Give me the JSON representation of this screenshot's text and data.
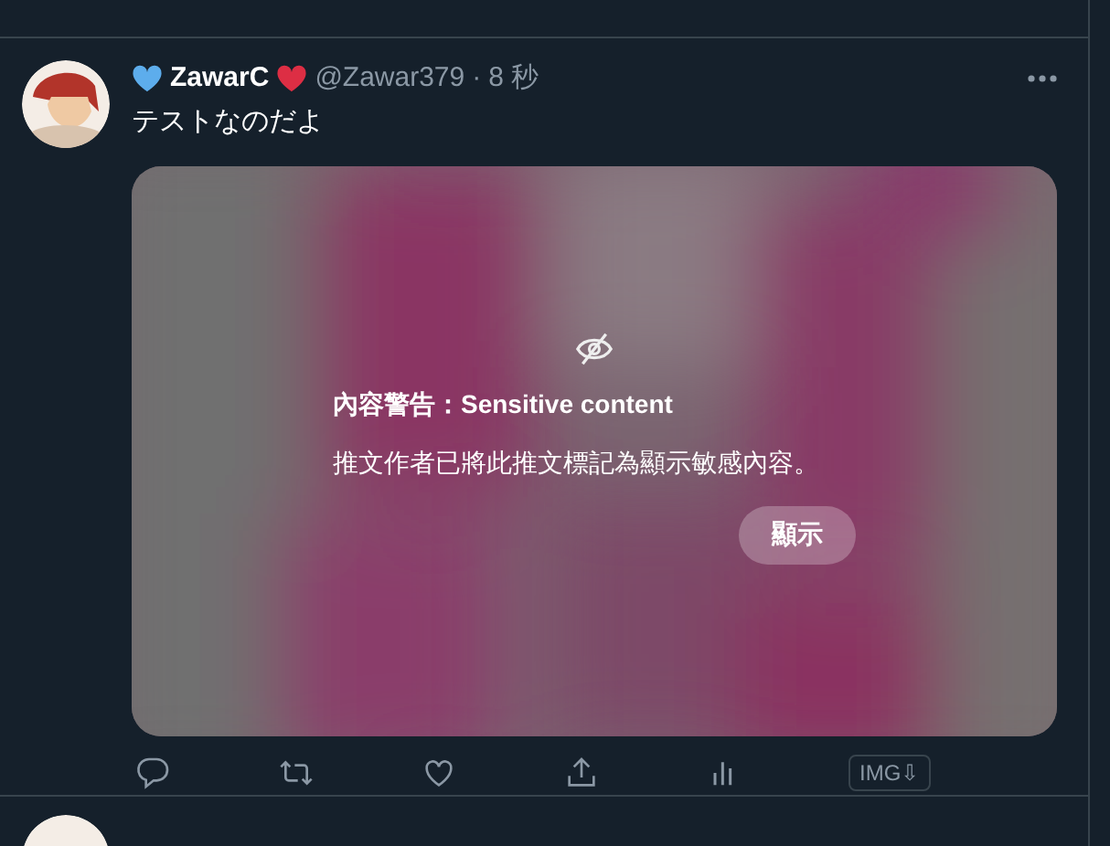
{
  "tweet": {
    "author": {
      "name": "ZawarC",
      "handle": "@Zawar379",
      "separator": "·",
      "time": "8 秒"
    },
    "text": "テストなのだよ",
    "media": {
      "kind": "picture",
      "warning_title": "內容警告：Sensitive content",
      "warning_text": "推文作者已將此推文標記為顯示敏感內容。",
      "show_button": "顯示"
    },
    "actions": [
      {
        "kind": "reply"
      },
      {
        "kind": "retweet"
      },
      {
        "kind": "like"
      },
      {
        "kind": "share"
      },
      {
        "kind": "analytics"
      },
      {
        "kind": "img",
        "label": "IMG⇩"
      }
    ]
  }
}
